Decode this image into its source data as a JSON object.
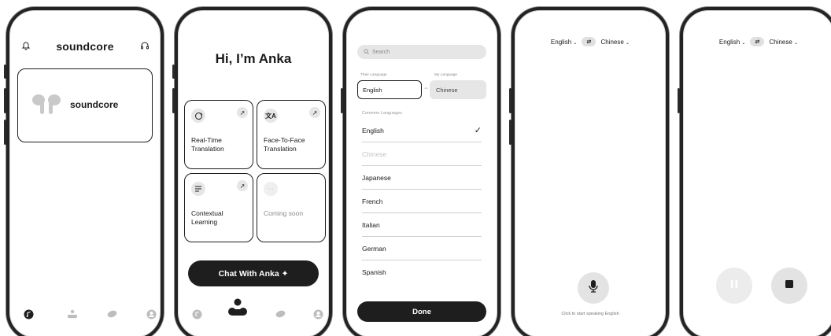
{
  "home": {
    "logo": "soundcore",
    "device_label": "soundcore",
    "icons": [
      "bell-icon",
      "headset-icon",
      "earbuds-icon"
    ],
    "nav": [
      "music-icon",
      "anka-icon",
      "explore-icon",
      "profile-icon"
    ]
  },
  "anka": {
    "greeting": "Hi, I’m Anka",
    "tiles": [
      {
        "label": "Real-Time Translation",
        "icon": "translate-cycle-icon"
      },
      {
        "label": "Face-To-Face Translation",
        "icon": "translate-chars-icon"
      },
      {
        "label": "Contextual Learning",
        "icon": "learning-icon"
      },
      {
        "label": "Coming soon",
        "icon": "more-icon"
      }
    ],
    "chat_button": "Chat With Anka ✦"
  },
  "picker": {
    "search_placeholder": "Search",
    "their_language_caption": "Their Language",
    "my_language_caption": "My Language",
    "their_language": "English",
    "my_language": "Chinese",
    "common_caption": "Common Languages",
    "languages": [
      "English",
      "Chinese",
      "Japanese",
      "French",
      "Italian",
      "German",
      "Spanish"
    ],
    "selected": "English",
    "done_button": "Done"
  },
  "translate_idle": {
    "source": "English",
    "target": "Chinese",
    "hint": "Click to start speaking English"
  },
  "translate_active": {
    "source": "English",
    "target": "Chinese"
  },
  "colors": {
    "dark": "#1e1e1e",
    "light_gray": "#e3e3e3",
    "muted": "#8a8a8a"
  }
}
